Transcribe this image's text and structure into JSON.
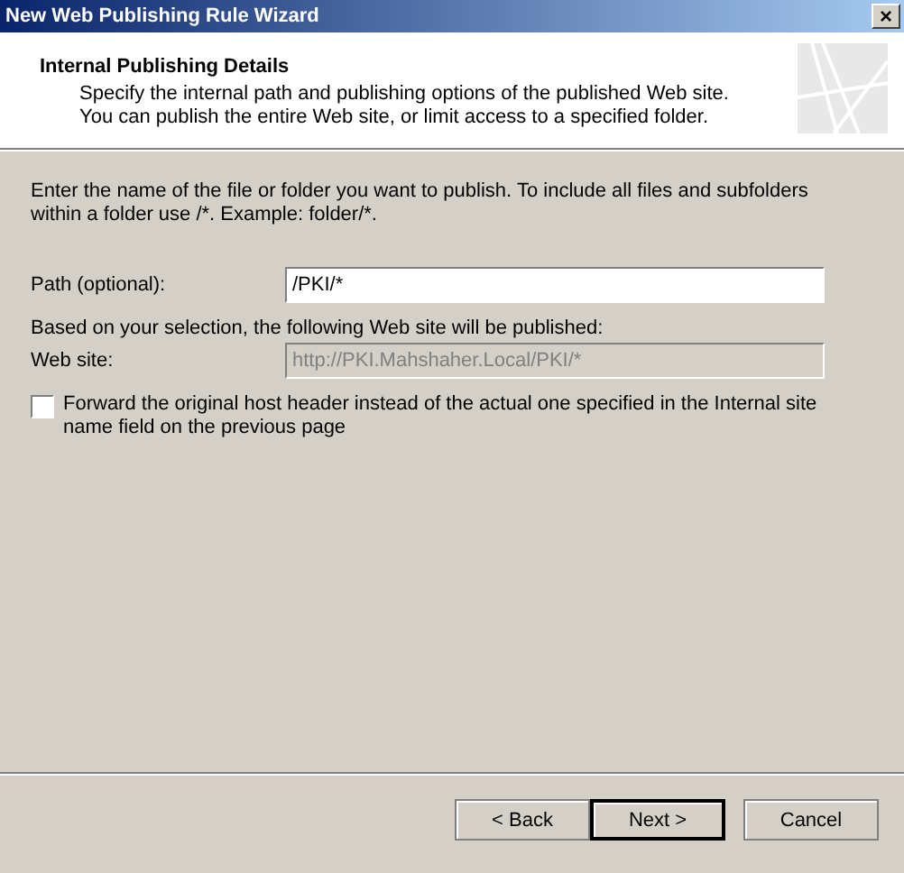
{
  "window": {
    "title": "New Web Publishing Rule Wizard",
    "close": "×"
  },
  "header": {
    "title": "Internal Publishing Details",
    "description": "Specify the internal path and publishing options of the published Web site. You can publish the entire Web site, or limit access to a specified folder."
  },
  "instructions": "Enter the name of the file or folder you want to publish. To include all files and subfolders within a folder use /*. Example: folder/*.",
  "path": {
    "label": "Path (optional):",
    "value": "/PKI/*"
  },
  "selection_note": "Based on your selection, the following Web site will be published:",
  "website": {
    "label": "Web site:",
    "value": "http://PKI.Mahshaher.Local/PKI/*",
    "disabled": true
  },
  "forward_header": {
    "label": "Forward the original host header instead of the actual one specified in the Internal site name field on the previous page",
    "checked": false
  },
  "buttons": [
    {
      "label": "< Back",
      "default": false
    },
    {
      "label": "Next >",
      "default": true
    },
    {
      "label": "Cancel",
      "default": false
    }
  ]
}
